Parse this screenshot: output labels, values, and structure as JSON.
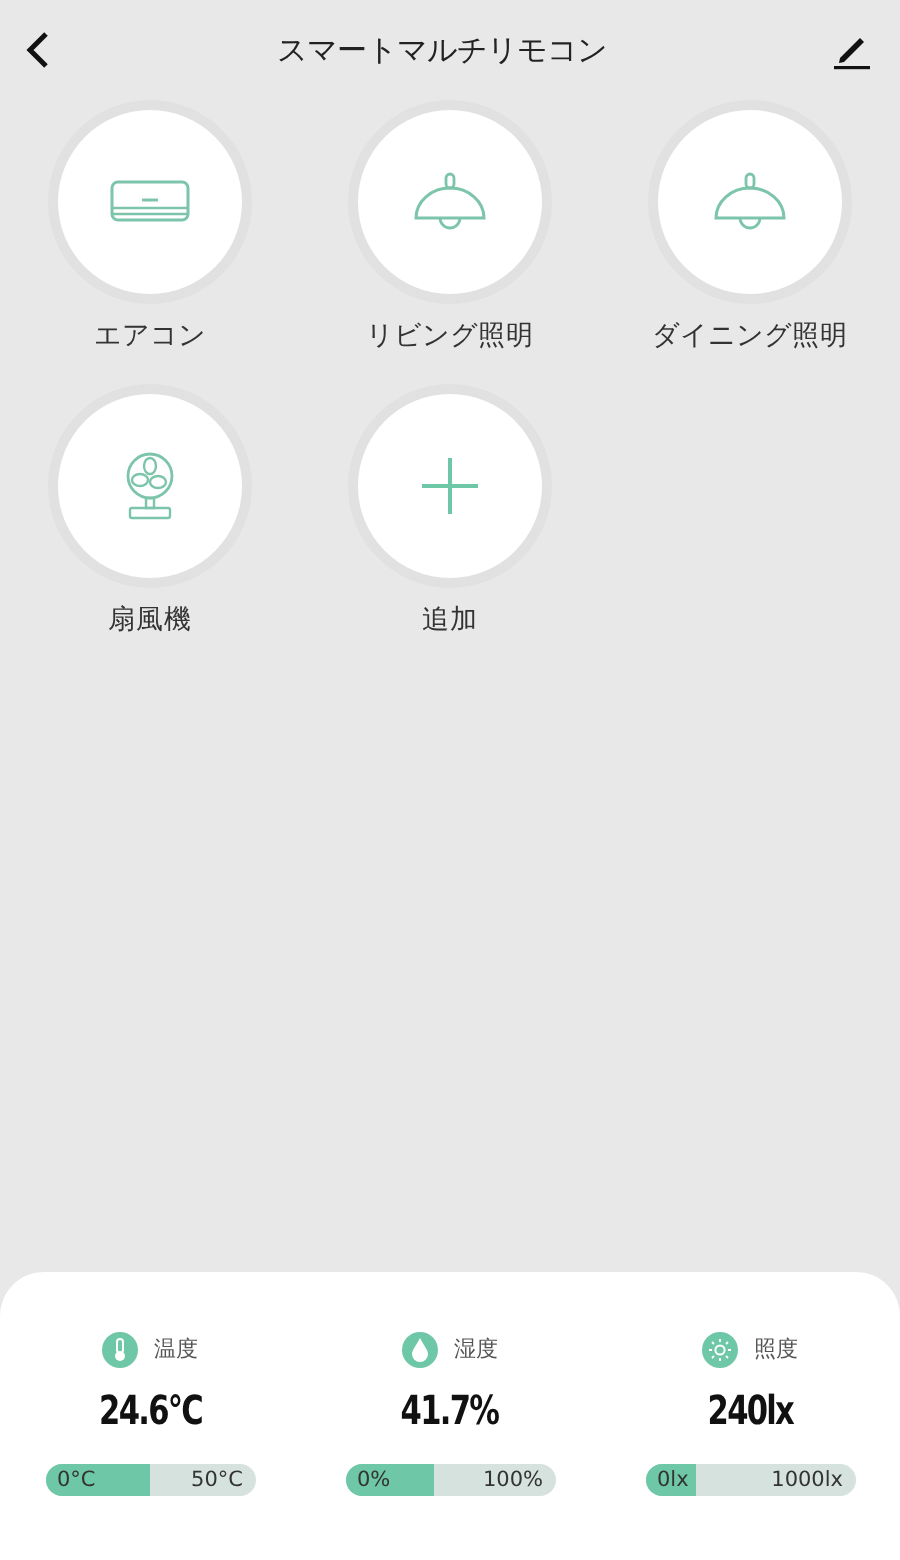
{
  "header": {
    "title": "スマートマルチリモコン"
  },
  "devices": [
    {
      "kind": "aircon",
      "label": "エアコン"
    },
    {
      "kind": "lamp",
      "label": "リビング照明"
    },
    {
      "kind": "lamp",
      "label": "ダイニング照明"
    },
    {
      "kind": "fan",
      "label": "扇風機"
    },
    {
      "kind": "add",
      "label": "追加"
    }
  ],
  "sensors": [
    {
      "kind": "thermometer",
      "label": "温度",
      "value": "24.6°C",
      "min": "0°C",
      "max": "50°C",
      "level": 0.5
    },
    {
      "kind": "drop",
      "label": "湿度",
      "value": "41.7%",
      "min": "0%",
      "max": "100%",
      "level": 0.42
    },
    {
      "kind": "sun",
      "label": "照度",
      "value": "240lx",
      "min": "0lx",
      "max": "1000lx",
      "level": 0.24
    }
  ]
}
